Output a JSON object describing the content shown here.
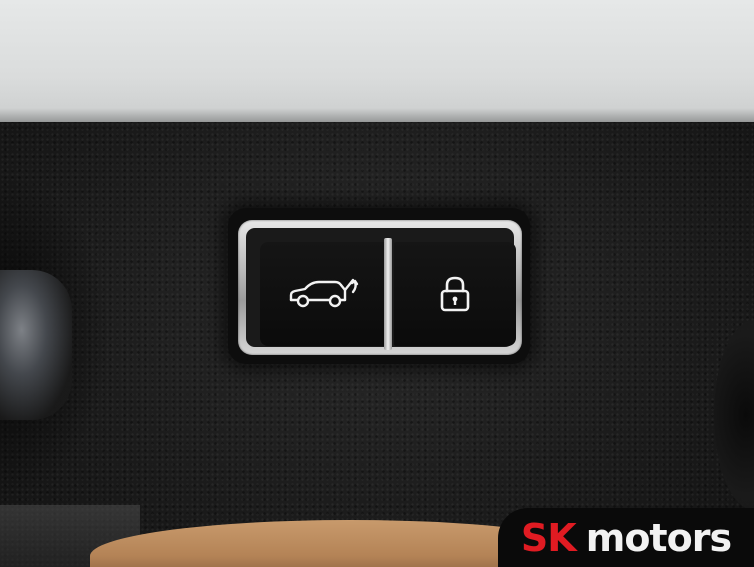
{
  "scene": {
    "subject": "tailgate-control-switches",
    "colors": {
      "paint": "#dadcdc",
      "trim": "#1c1c1c",
      "bezel": "#bdbdbd",
      "interior": "#c89a6c",
      "icon": "#f2f2f2"
    }
  },
  "switches": [
    {
      "name": "power-tailgate-button",
      "icon": "suv-tailgate-open-icon"
    },
    {
      "name": "lock-button",
      "icon": "padlock-icon"
    }
  ],
  "watermark": {
    "brand_part1": "SK",
    "brand_part2": "motors",
    "brand_part1_color": "#e01b22",
    "brand_part2_color": "#f2f2f2"
  }
}
